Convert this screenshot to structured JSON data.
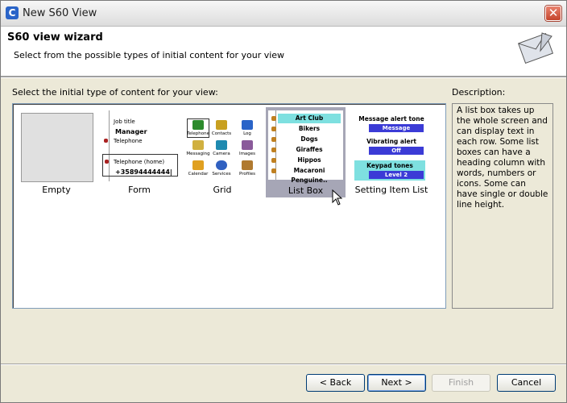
{
  "window": {
    "title": "New S60 View",
    "close": "✕"
  },
  "wizard": {
    "title": "S60 view wizard",
    "subtitle": "Select from the possible types of initial content for your view"
  },
  "main": {
    "select_label": "Select the initial type of content for your view:",
    "description_label": "Description:",
    "description": "A list box takes up the whole screen and can display text in each row. Some list boxes can have a heading column with words, numbers or icons. Some can have single or double line height.",
    "options": [
      {
        "label": "Empty"
      },
      {
        "label": "Form"
      },
      {
        "label": "Grid"
      },
      {
        "label": "List Box"
      },
      {
        "label": "Setting Item List"
      }
    ],
    "form_preview": {
      "job_title": "Job title",
      "manager": "Manager",
      "telephone": "Telephone",
      "tel_home": "Telephone (home)",
      "number": "+35894444444|"
    },
    "grid_preview": [
      "Telephone",
      "Contacts",
      "Log",
      "Messaging",
      "Camera",
      "Images",
      "Calendar",
      "Services",
      "Profiles"
    ],
    "listbox_preview": [
      "Art Club",
      "Bikers",
      "Dogs",
      "Giraffes",
      "Hippos",
      "Macaroni Penguine.."
    ],
    "setting_preview": [
      {
        "name": "Message alert tone",
        "value": "Message"
      },
      {
        "name": "Vibrating alert",
        "value": "Off"
      },
      {
        "name": "Keypad tones",
        "value": "Level 2"
      }
    ]
  },
  "buttons": {
    "back": "< Back",
    "next": "Next >",
    "finish": "Finish",
    "cancel": "Cancel"
  },
  "colors": {
    "selection": "#a6a6b6",
    "highlight": "#7ee0e0",
    "value_bar": "#3b3bd6"
  }
}
